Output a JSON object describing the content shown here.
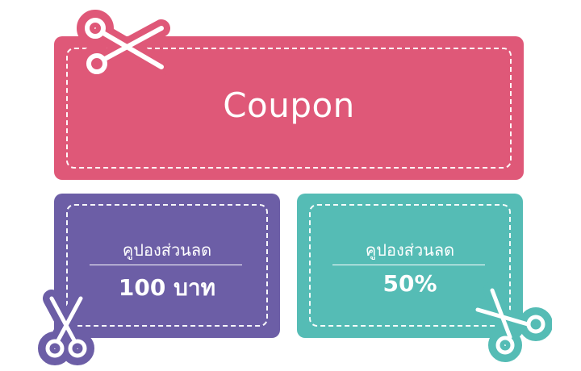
{
  "colors": {
    "main": "#DF5878",
    "discount_amount": "#6C5EA6",
    "discount_percent": "#55BCB5",
    "text": "#FFFFFF"
  },
  "main_coupon": {
    "title": "Coupon"
  },
  "coupons": [
    {
      "label": "คูปองส่วนลด",
      "value": "100 บาท"
    },
    {
      "label": "คูปองส่วนลด",
      "value": "50%"
    }
  ],
  "icons": [
    "scissors-icon",
    "scissors-icon",
    "scissors-icon"
  ]
}
